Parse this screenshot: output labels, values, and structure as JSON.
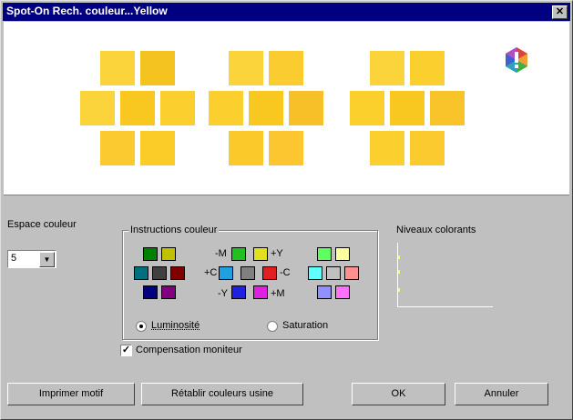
{
  "window": {
    "title": "Spot-On Rech. couleur...Yellow",
    "close_glyph": "✕"
  },
  "colors": {
    "center_yellow": "#f8c820",
    "swatch_groups": [
      [
        "#fbd33a",
        "#f4c320",
        "#fbd33a",
        "#f8c820",
        "#fbcf2e",
        "#fbc930",
        "#fbcc28"
      ],
      [
        "#fbd33a",
        "#fbcc30",
        "#fbcf2e",
        "#f8c820",
        "#f8c028",
        "#fbca2a",
        "#fbc630"
      ],
      [
        "#fbd33a",
        "#fbcf2e",
        "#fbd02c",
        "#f8c820",
        "#f9c32a",
        "#fbcf2e",
        "#fbca2e"
      ]
    ],
    "instr_left": [
      "#008000",
      "#c0c000",
      "#007080",
      "#404040",
      "#800000",
      "#000080",
      "#800080"
    ],
    "instr_mid": [
      "#20c020",
      "#e0e020",
      "#20a0e0",
      "#808080",
      "#e02020",
      "#2020e0",
      "#e020e0"
    ],
    "instr_right": [
      "#60ff60",
      "#ffffa0",
      "#60ffff",
      "#c0c0c0",
      "#ff9090",
      "#9090ff",
      "#ff70ff"
    ]
  },
  "espace": {
    "label": "Espace couleur",
    "value": "5"
  },
  "instructions": {
    "title": "Instructions couleur",
    "m_minus": "-M",
    "y_plus": "+Y",
    "c_plus": "+C",
    "c_minus": "-C",
    "y_minus": "-Y",
    "m_plus": "+M",
    "luminosite": "Luminosité",
    "saturation": "Saturation"
  },
  "niveaux": {
    "label": "Niveaux colorants"
  },
  "compensation": {
    "label": "Compensation moniteur",
    "checked": true
  },
  "buttons": {
    "imprimer": "Imprimer motif",
    "retablir": "Rétablir couleurs usine",
    "ok": "OK",
    "annuler": "Annuler"
  }
}
